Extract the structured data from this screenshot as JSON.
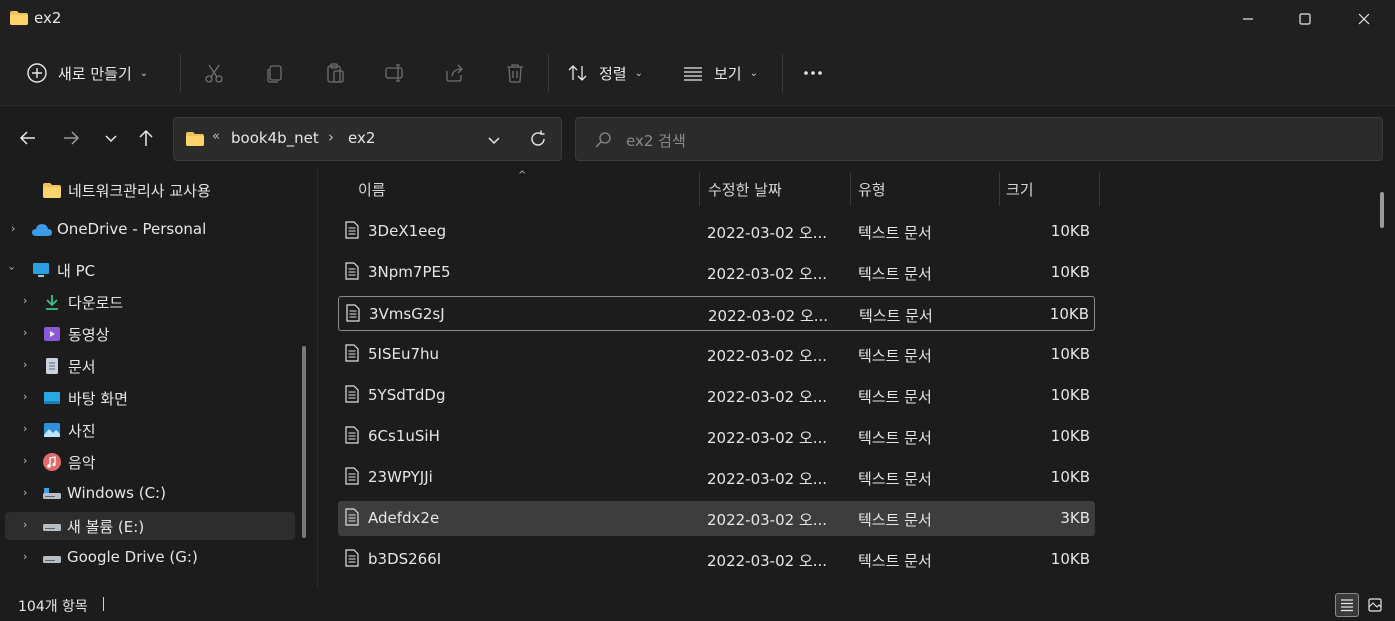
{
  "window": {
    "title": "ex2",
    "minimize_icon": "minimize-icon",
    "maximize_icon": "maximize-icon",
    "close_icon": "close-icon"
  },
  "toolbar": {
    "new_label": "새로 만들기",
    "sort_label": "정렬",
    "view_label": "보기"
  },
  "address": {
    "overflow": "«",
    "segments": [
      "book4b_net",
      "ex2"
    ],
    "separator": "›"
  },
  "search": {
    "placeholder": "ex2 검색"
  },
  "sidebar": {
    "items": [
      {
        "label": "네트워크관리사 교사용",
        "icon": "folder-icon"
      },
      {
        "label": "OneDrive - Personal",
        "icon": "cloud-icon"
      },
      {
        "label": "내 PC",
        "icon": "computer-icon"
      },
      {
        "label": "다운로드",
        "icon": "download-icon"
      },
      {
        "label": "동영상",
        "icon": "video-icon"
      },
      {
        "label": "문서",
        "icon": "document-icon"
      },
      {
        "label": "바탕 화면",
        "icon": "desktop-icon"
      },
      {
        "label": "사진",
        "icon": "picture-icon"
      },
      {
        "label": "음악",
        "icon": "music-icon"
      },
      {
        "label": "Windows (C:)",
        "icon": "drive-icon"
      },
      {
        "label": "새 볼륨 (E:)",
        "icon": "drive-icon"
      },
      {
        "label": "Google Drive (G:)",
        "icon": "drive-icon"
      }
    ]
  },
  "columns": {
    "name": "이름",
    "date": "수정한 날짜",
    "type": "유형",
    "size": "크기"
  },
  "files": [
    {
      "name": "3DeX1eeg",
      "date": "2022-03-02 오...",
      "type": "텍스트 문서",
      "size": "10KB"
    },
    {
      "name": "3Npm7PE5",
      "date": "2022-03-02 오...",
      "type": "텍스트 문서",
      "size": "10KB"
    },
    {
      "name": "3VmsG2sJ",
      "date": "2022-03-02 오...",
      "type": "텍스트 문서",
      "size": "10KB"
    },
    {
      "name": "5ISEu7hu",
      "date": "2022-03-02 오...",
      "type": "텍스트 문서",
      "size": "10KB"
    },
    {
      "name": "5YSdTdDg",
      "date": "2022-03-02 오...",
      "type": "텍스트 문서",
      "size": "10KB"
    },
    {
      "name": "6Cs1uSiH",
      "date": "2022-03-02 오...",
      "type": "텍스트 문서",
      "size": "10KB"
    },
    {
      "name": "23WPYJJi",
      "date": "2022-03-02 오...",
      "type": "텍스트 문서",
      "size": "10KB"
    },
    {
      "name": "Adefdx2e",
      "date": "2022-03-02 오...",
      "type": "텍스트 문서",
      "size": "3KB"
    },
    {
      "name": "b3DS266I",
      "date": "2022-03-02 오...",
      "type": "텍스트 문서",
      "size": "10KB"
    }
  ],
  "status": {
    "count": "104개 항목"
  }
}
